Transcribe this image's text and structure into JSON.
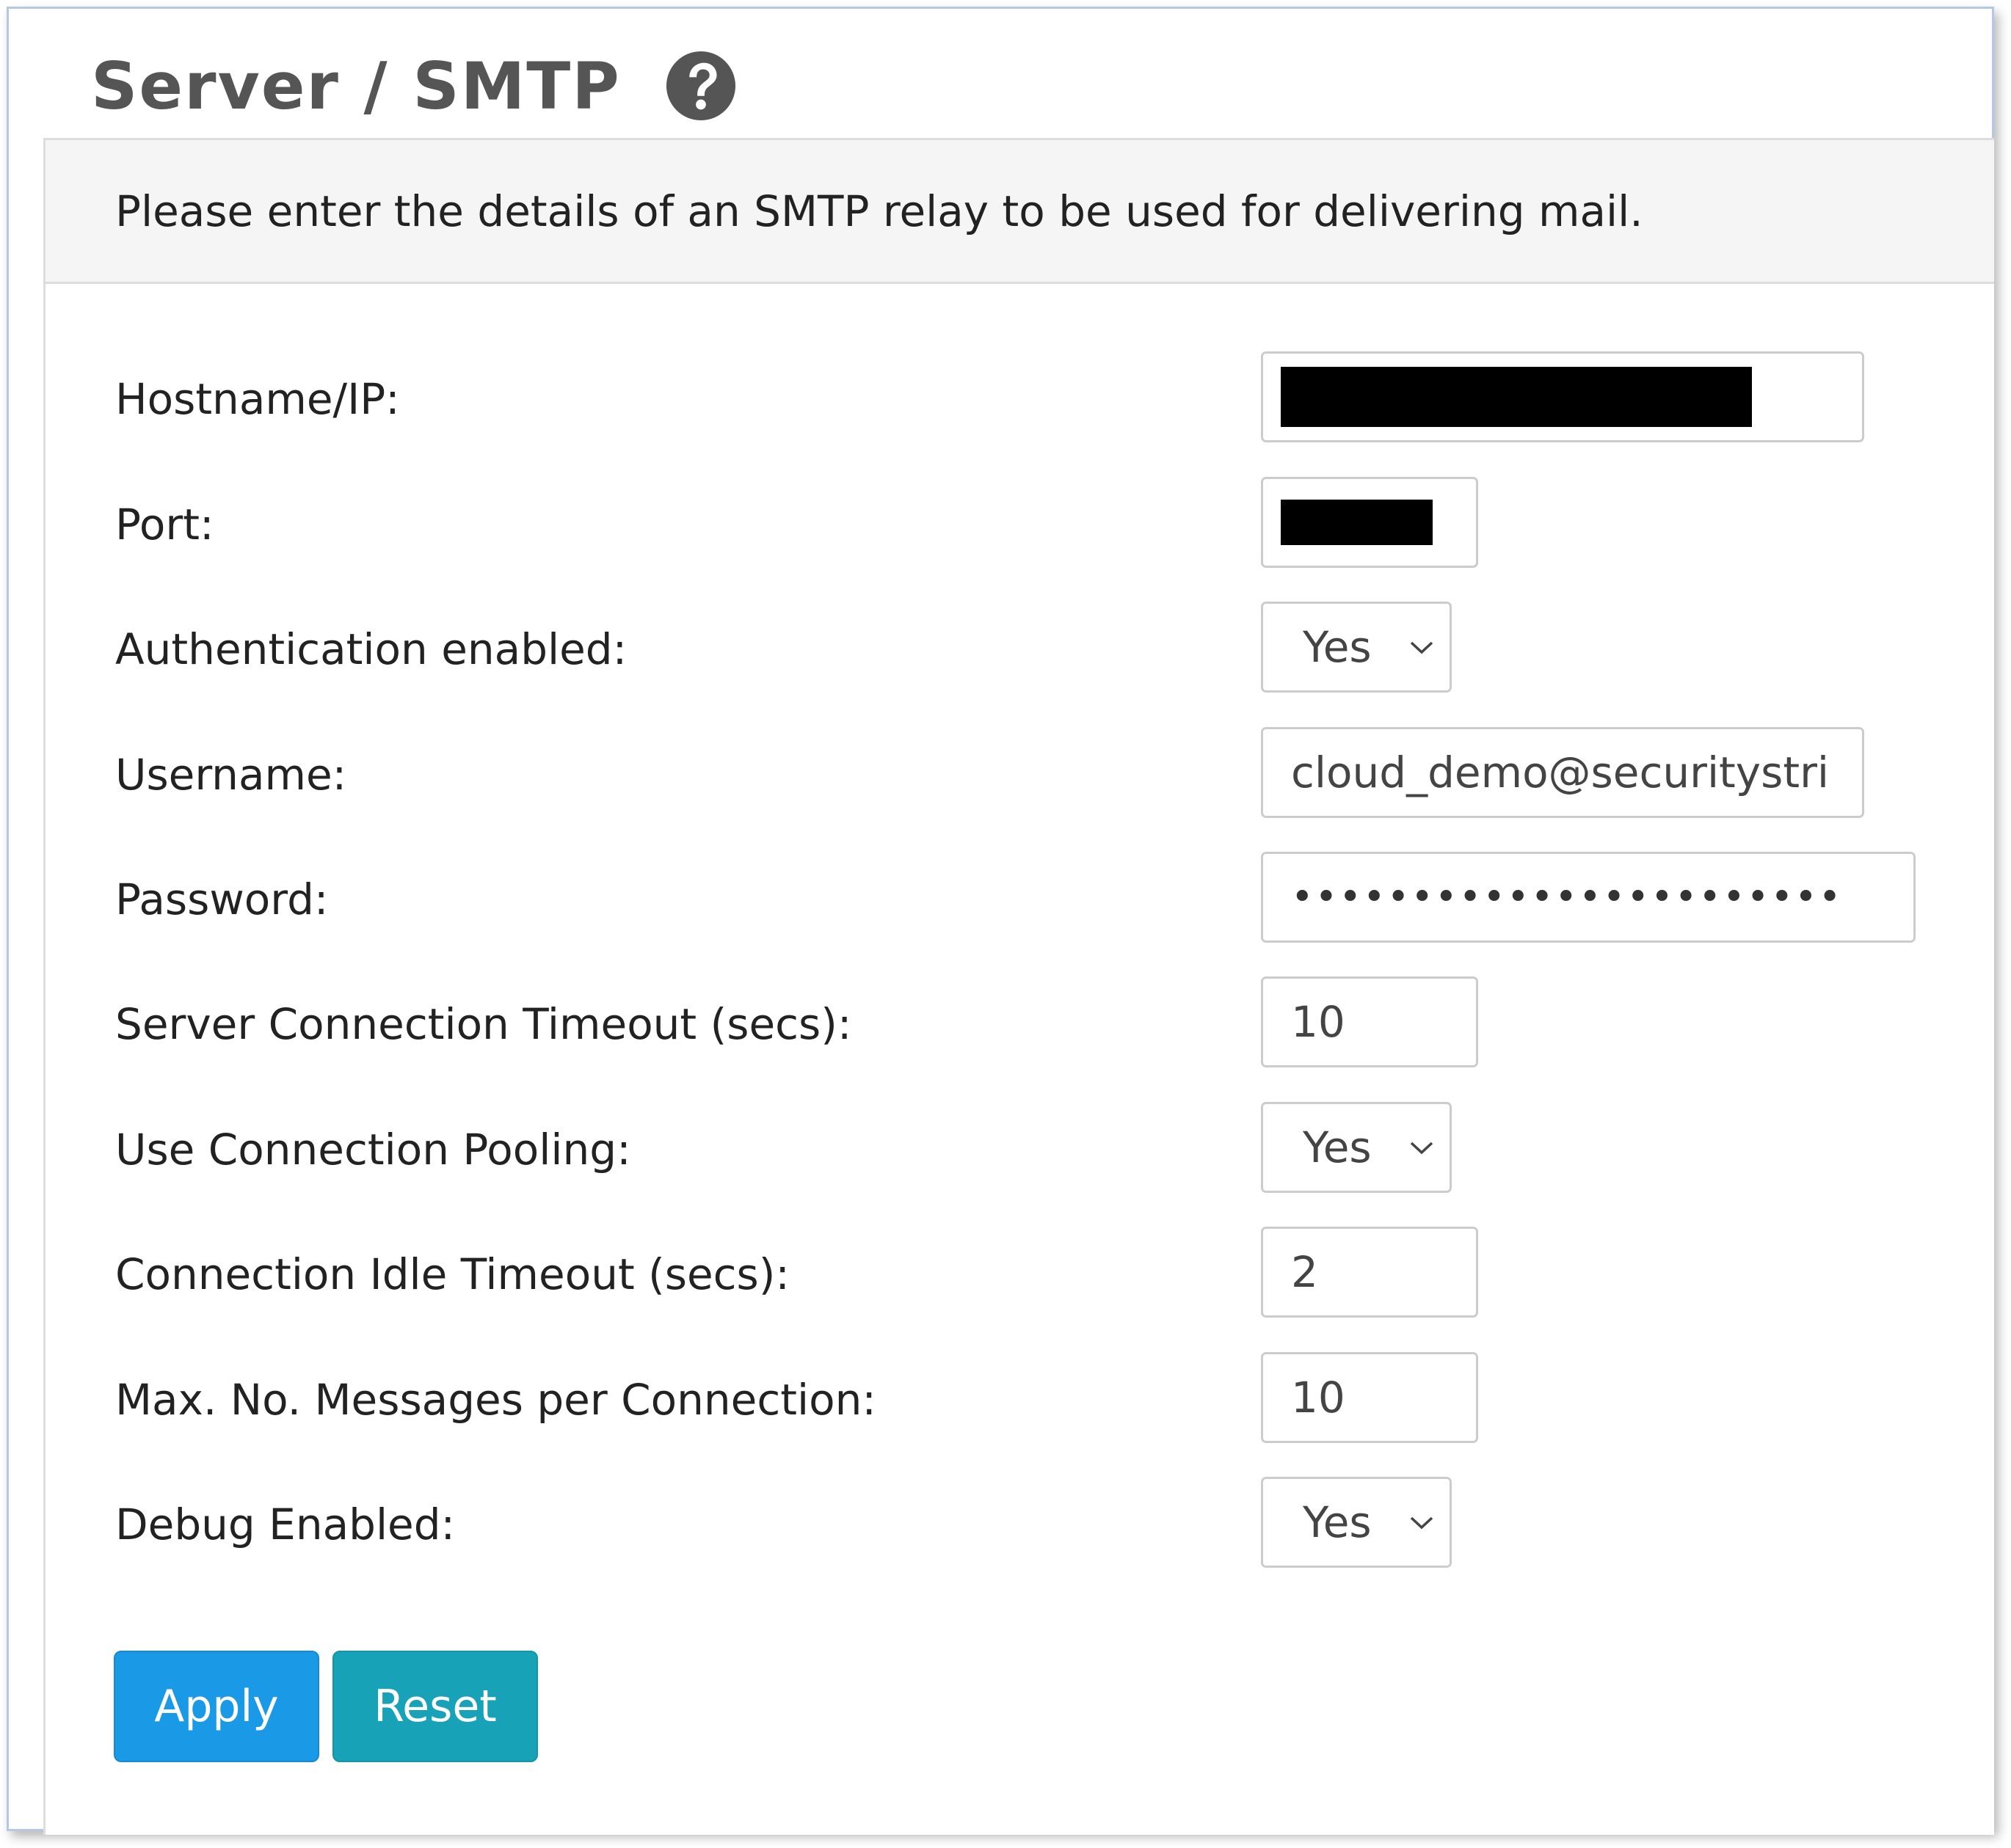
{
  "header": {
    "title": "Server / SMTP"
  },
  "panel": {
    "heading": "Please enter the details of an SMTP relay to be used for delivering mail."
  },
  "form": {
    "hostname": {
      "label": "Hostname/IP:"
    },
    "port": {
      "label": "Port:"
    },
    "auth_enabled": {
      "label": "Authentication enabled:",
      "value": "Yes"
    },
    "username": {
      "label": "Username:",
      "value": "cloud_demo@securitystri"
    },
    "password": {
      "label": "Password:",
      "value": "•••••••••••••••••••••••"
    },
    "server_timeout": {
      "label": "Server Connection Timeout (secs):",
      "value": "10"
    },
    "connection_pooling": {
      "label": "Use Connection Pooling:",
      "value": "Yes"
    },
    "idle_timeout": {
      "label": "Connection Idle Timeout (secs):",
      "value": "2"
    },
    "max_messages": {
      "label": "Max. No. Messages per Connection:",
      "value": "10"
    },
    "debug_enabled": {
      "label": "Debug Enabled:",
      "value": "Yes"
    }
  },
  "actions": {
    "apply_label": "Apply",
    "reset_label": "Reset"
  },
  "colors": {
    "apply_button": "#1a9ae6",
    "reset_button": "#17a2b8",
    "title_text": "#555555",
    "panel_heading_bg": "#f5f5f5"
  },
  "icons": {
    "help": "question-circle-icon",
    "select_arrow": "chevron-down-icon"
  }
}
